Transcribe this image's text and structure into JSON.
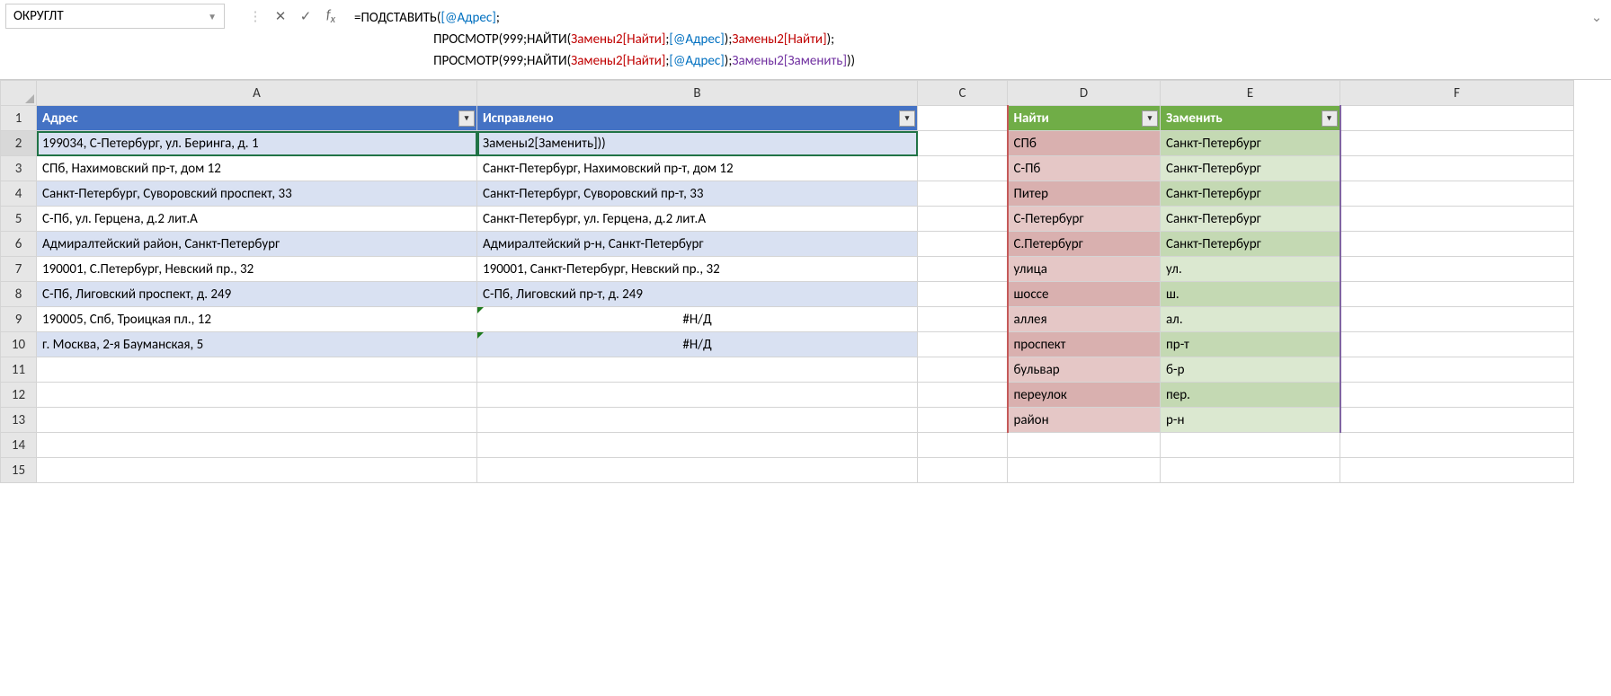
{
  "nameBox": "ОКРУГЛТ",
  "formula": {
    "line1": [
      {
        "t": "=ПОДСТАВИТЬ(",
        "c": "c-black"
      },
      {
        "t": "[@Адрес]",
        "c": "c-blue"
      },
      {
        "t": ";",
        "c": "c-black"
      }
    ],
    "line2": [
      {
        "t": "                          ПРОСМОТР(999;НАЙТИ(",
        "c": "c-black"
      },
      {
        "t": "Замены2[Найти]",
        "c": "c-darkred"
      },
      {
        "t": ";",
        "c": "c-black"
      },
      {
        "t": "[@Адрес]",
        "c": "c-blue"
      },
      {
        "t": ");",
        "c": "c-black"
      },
      {
        "t": "Замены2[Найти]",
        "c": "c-darkred"
      },
      {
        "t": ");",
        "c": "c-black"
      }
    ],
    "line3": [
      {
        "t": "                          ПРОСМОТР(999;НАЙТИ(",
        "c": "c-black"
      },
      {
        "t": "Замены2[Найти]",
        "c": "c-darkred"
      },
      {
        "t": ";",
        "c": "c-black"
      },
      {
        "t": "[@Адрес]",
        "c": "c-blue"
      },
      {
        "t": ");",
        "c": "c-black"
      },
      {
        "t": "Замены2[Заменить]",
        "c": "c-purple"
      },
      {
        "t": "))",
        "c": "c-black"
      }
    ]
  },
  "columns": [
    "A",
    "B",
    "C",
    "D",
    "E",
    "F"
  ],
  "table1": {
    "headers": [
      "Адрес",
      "Исправлено"
    ],
    "rows": [
      [
        "199034, С-Петербург, ул. Беринга, д. 1",
        "Замены2[Заменить]))"
      ],
      [
        "СПб, Нахимовский пр-т, дом 12",
        "Санкт-Петербург, Нахимовский пр-т, дом 12"
      ],
      [
        "Санкт-Петербург, Суворовский проспект, 33",
        "Санкт-Петербург, Суворовский пр-т, 33"
      ],
      [
        "С-Пб, ул. Герцена, д.2 лит.А",
        "Санкт-Петербург, ул. Герцена, д.2 лит.А"
      ],
      [
        "Адмиралтейский район, Санкт-Петербург",
        "Адмиралтейский р-н, Санкт-Петербург"
      ],
      [
        "190001, С.Петербург, Невский пр., 32",
        "190001, Санкт-Петербург, Невский пр., 32"
      ],
      [
        "С-Пб, Лиговский проспект, д. 249",
        "С-Пб, Лиговский пр-т, д. 249"
      ],
      [
        "190005, Спб, Троицкая пл., 12",
        "#Н/Д"
      ],
      [
        "г. Москва, 2-я Бауманская, 5",
        "#Н/Д"
      ]
    ]
  },
  "table2": {
    "headers": [
      "Найти",
      "Заменить"
    ],
    "rows": [
      [
        "СПб",
        "Санкт-Петербург"
      ],
      [
        "С-Пб",
        "Санкт-Петербург"
      ],
      [
        "Питер",
        "Санкт-Петербург"
      ],
      [
        "С-Петербург",
        "Санкт-Петербург"
      ],
      [
        "С.Петербург",
        "Санкт-Петербург"
      ],
      [
        "улица",
        "ул."
      ],
      [
        "шоссе",
        "ш."
      ],
      [
        "аллея",
        "ал."
      ],
      [
        "проспект",
        "пр-т"
      ],
      [
        "бульвар",
        "б-р"
      ],
      [
        "переулок",
        "пер."
      ],
      [
        "район",
        "р-н"
      ]
    ]
  },
  "rowNumbers": [
    1,
    2,
    3,
    4,
    5,
    6,
    7,
    8,
    9,
    10,
    11,
    12,
    13,
    14,
    15
  ]
}
